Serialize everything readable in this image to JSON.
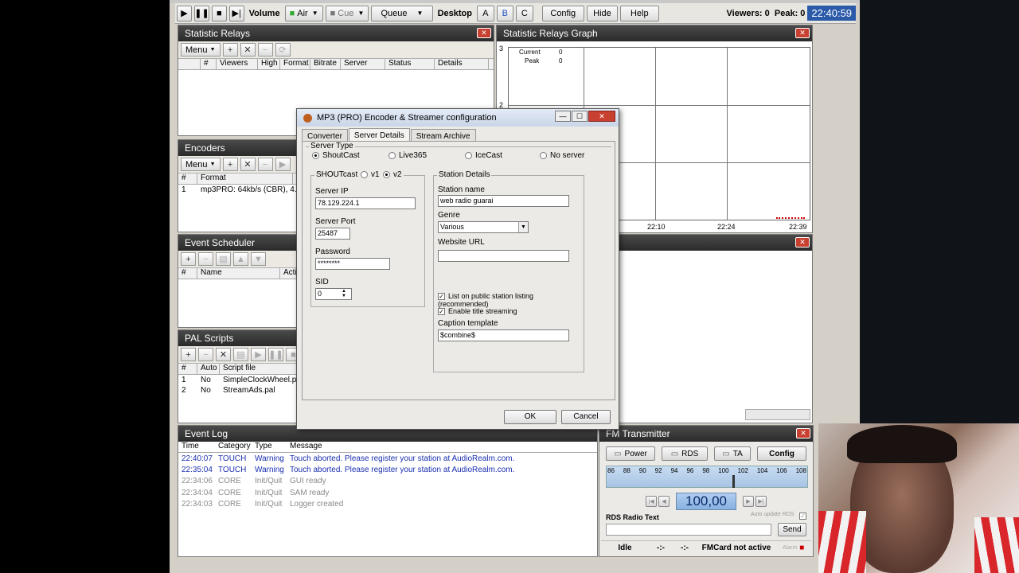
{
  "toolbar": {
    "volume_label": "Volume",
    "air_label": "Air",
    "cue_label": "Cue",
    "queue_label": "Queue",
    "desktop_label": "Desktop",
    "desktop_a": "A",
    "desktop_b": "B",
    "desktop_c": "C",
    "config_label": "Config",
    "hide_label": "Hide",
    "help_label": "Help",
    "viewers_text": "Viewers: 0  Peak: 0",
    "clock": "22:40:59"
  },
  "relays": {
    "title": "Statistic Relays",
    "menu_label": "Menu",
    "columns": [
      "#",
      "Viewers",
      "High",
      "Format",
      "Bitrate",
      "Server",
      "Status",
      "Details"
    ]
  },
  "graph": {
    "title": "Statistic Relays Graph",
    "legend_current": "Current",
    "legend_current_val": "0",
    "legend_peak": "Peak",
    "legend_peak_val": "0",
    "y_top": "3",
    "y_mid": "2",
    "x_ticks": [
      "22:10",
      "22:24",
      "22:39"
    ]
  },
  "encoders": {
    "title": "Encoders",
    "menu_label": "Menu",
    "columns": [
      "#",
      "Format"
    ],
    "rows": [
      {
        "num": "1",
        "format": "mp3PRO: 64kb/s (CBR), 4..."
      }
    ]
  },
  "scheduler": {
    "title": "Event Scheduler",
    "columns": [
      "#",
      "Name",
      "Actio"
    ]
  },
  "pal": {
    "title": "PAL Scripts",
    "columns": [
      "#",
      "Auto",
      "Script file"
    ],
    "rows": [
      {
        "num": "1",
        "auto": "No",
        "file": "SimpleClockWheel.pal"
      },
      {
        "num": "2",
        "auto": "No",
        "file": "StreamAds.pal"
      }
    ]
  },
  "eventlog": {
    "title": "Event Log",
    "columns": [
      "Time",
      "Category",
      "Type",
      "Message"
    ],
    "rows": [
      {
        "time": "22:40:07",
        "cat": "TOUCH",
        "type": "Warning",
        "msg": "Touch aborted. Please register your station at AudioRealm.com.",
        "color": "#1a2fb0"
      },
      {
        "time": "22:35:04",
        "cat": "TOUCH",
        "type": "Warning",
        "msg": "Touch aborted. Please register your station at AudioRealm.com.",
        "color": "#1a2fb0"
      },
      {
        "time": "22:34:06",
        "cat": "CORE",
        "type": "Init/Quit",
        "msg": "GUI ready",
        "color": "#8a8a8a"
      },
      {
        "time": "22:34:04",
        "cat": "CORE",
        "type": "Init/Quit",
        "msg": "SAM ready",
        "color": "#8a8a8a"
      },
      {
        "time": "22:34:03",
        "cat": "CORE",
        "type": "Init/Quit",
        "msg": "Logger created",
        "color": "#8a8a8a"
      }
    ]
  },
  "fm": {
    "title": "FM Transmitter",
    "power": "Power",
    "rds": "RDS",
    "ta": "TA",
    "config": "Config",
    "scale": [
      "86",
      "88",
      "90",
      "92",
      "94",
      "96",
      "98",
      "100",
      "102",
      "104",
      "106",
      "108"
    ],
    "frequency": "100,00",
    "rds_label": "RDS Radio Text",
    "auto_update": "Auto update RDS",
    "send": "Send",
    "status_idle": "Idle",
    "status_a": "-:-",
    "status_b": "-:-",
    "status_card": "FMCard not active",
    "alarm": "Alarm"
  },
  "dialog": {
    "title": "MP3 (PRO) Encoder & Streamer configuration",
    "tabs": [
      "Converter",
      "Server Details",
      "Stream Archive"
    ],
    "server_type_label": "Server Type",
    "server_types": [
      "ShoutCast",
      "Live365",
      "IceCast",
      "No server"
    ],
    "shoutcast_label": "SHOUTcast",
    "v1": "v1",
    "v2": "v2",
    "server_ip_label": "Server IP",
    "server_ip": "78.129.224.1",
    "server_port_label": "Server Port",
    "server_port": "25487",
    "password_label": "Password",
    "password": "********",
    "sid_label": "SID",
    "sid": "0",
    "station_details_label": "Station Details",
    "station_name_label": "Station name",
    "station_name": "web radio guarai",
    "genre_label": "Genre",
    "genre": "Various",
    "website_label": "Website URL",
    "website": "",
    "list_public": "List on public station listing (recommended)",
    "title_streaming": "Enable title streaming",
    "caption_label": "Caption template",
    "caption": "$combine$",
    "ok": "OK",
    "cancel": "Cancel"
  }
}
